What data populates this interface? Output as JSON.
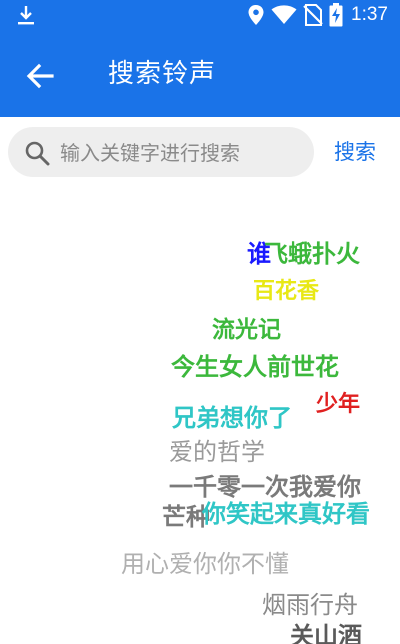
{
  "status_bar": {
    "time": "1:37",
    "icons": [
      "download-icon",
      "location-icon",
      "wifi-icon",
      "no-sim-icon",
      "battery-charging-icon"
    ]
  },
  "app_bar": {
    "title": "搜索铃声",
    "back_icon": "arrow-back-icon"
  },
  "search": {
    "placeholder": "输入关键字进行搜索",
    "value": "",
    "button_label": "搜索",
    "icon": "search-icon"
  },
  "tags": [
    {
      "text": "谁",
      "color": "#1a1aff"
    },
    {
      "text": "飞蛾扑火",
      "color": "#3cb83c"
    },
    {
      "text": "百花香",
      "color": "#e8e815"
    },
    {
      "text": "流光记",
      "color": "#3cb83c"
    },
    {
      "text": "今生女人前世花",
      "color": "#3cb83c"
    },
    {
      "text": "少年",
      "color": "#e02020"
    },
    {
      "text": "兄弟想你了",
      "color": "#2fc6c6"
    },
    {
      "text": "爱的哲学",
      "color": "#9a9a9a"
    },
    {
      "text": "一千零一次我爱你",
      "color": "#7a7a7a"
    },
    {
      "text": "芒种",
      "color": "#7a7a7a"
    },
    {
      "text": "你笑起来真好看",
      "color": "#2fc6c6"
    },
    {
      "text": "用心爱你你不懂",
      "color": "#b0b0b0"
    },
    {
      "text": "烟雨行舟",
      "color": "#8a8a8a"
    },
    {
      "text": "关山酒",
      "color": "#5a5a5a"
    }
  ],
  "colors": {
    "primary": "#1a73e8",
    "search_bg": "#eeeeee"
  }
}
